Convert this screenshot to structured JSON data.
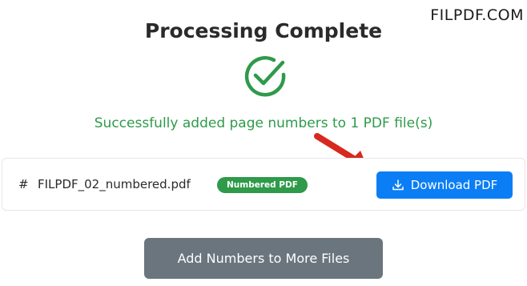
{
  "watermark": "FILPDF.COM",
  "heading": "Processing Complete",
  "success_message": "Successfully added page numbers to 1 PDF file(s)",
  "file": {
    "hash": "#",
    "name": "FILPDF_02_numbered.pdf",
    "badge": "Numbered PDF",
    "download_label": "Download PDF"
  },
  "more_button_label": "Add Numbers to More Files",
  "icons": {
    "success": "check-circle-icon",
    "download": "download-icon",
    "annotation": "red-arrow-icon"
  },
  "colors": {
    "success_green": "#2e9a4a",
    "primary_blue": "#0b7ef5",
    "secondary_gray": "#6b757e",
    "arrow_red": "#d8281f"
  }
}
